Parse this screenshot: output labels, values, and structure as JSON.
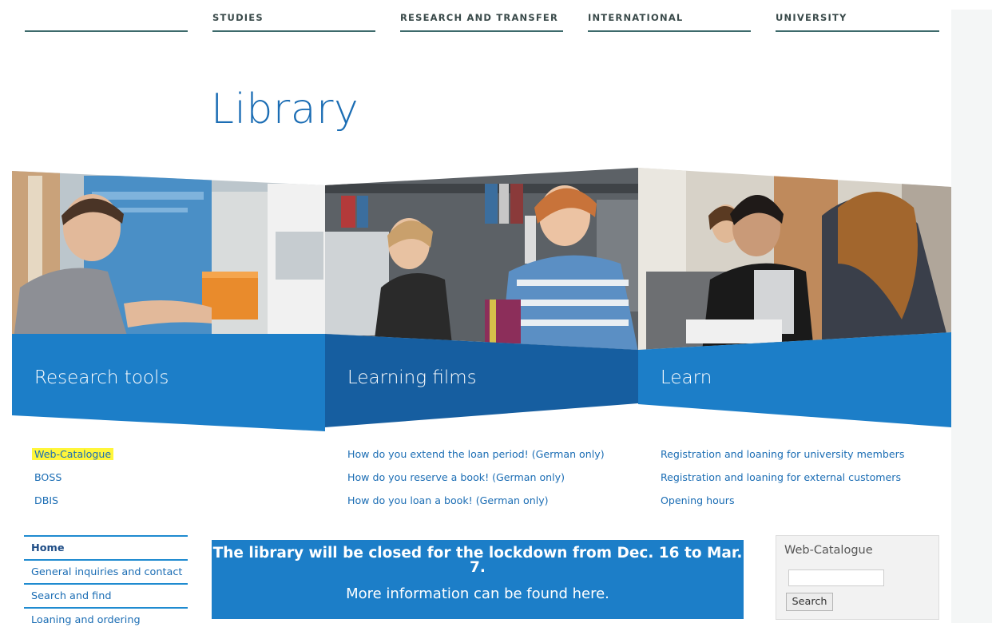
{
  "nav": {
    "items": [
      {
        "label": ""
      },
      {
        "label": "STUDIES"
      },
      {
        "label": "RESEARCH AND TRANSFER"
      },
      {
        "label": "INTERNATIONAL"
      },
      {
        "label": "UNIVERSITY"
      }
    ]
  },
  "page": {
    "title": "Library"
  },
  "tiles": [
    {
      "title": "Research tools",
      "image": "student-at-bookshelf-photo"
    },
    {
      "title": "Learning films",
      "image": "students-with-books-photo"
    },
    {
      "title": "Learn",
      "image": "student-writing-at-laptop-photo"
    }
  ],
  "links": {
    "research_tools": [
      "Web-Catalogue",
      "BOSS",
      "DBIS"
    ],
    "learning_films": [
      "How do you extend the loan period! (German only)",
      "How do you reserve a book! (German only)",
      "How do you loan a book! (German only)"
    ],
    "learn": [
      "Registration and loaning for university members",
      "Registration and loaning for external customers",
      "Opening hours"
    ]
  },
  "sidebar": {
    "items": [
      {
        "label": "Home"
      },
      {
        "label": "General inquiries and contact"
      },
      {
        "label": "Search and find"
      },
      {
        "label": "Loaning and ordering"
      }
    ]
  },
  "notice": {
    "line1": "The library will be closed for the lockdown from Dec. 16 to Mar. 7.",
    "line2": "More information can be found here."
  },
  "catalogue_box": {
    "title": "Web-Catalogue",
    "input_value": "",
    "button_label": "Search"
  },
  "colors": {
    "brand_blue": "#1b6db4",
    "panel_blue": "#1c7ec8",
    "panel_blue_dark": "#165ea0",
    "nav_line": "#3d6a6b",
    "highlight": "#fff63a"
  }
}
